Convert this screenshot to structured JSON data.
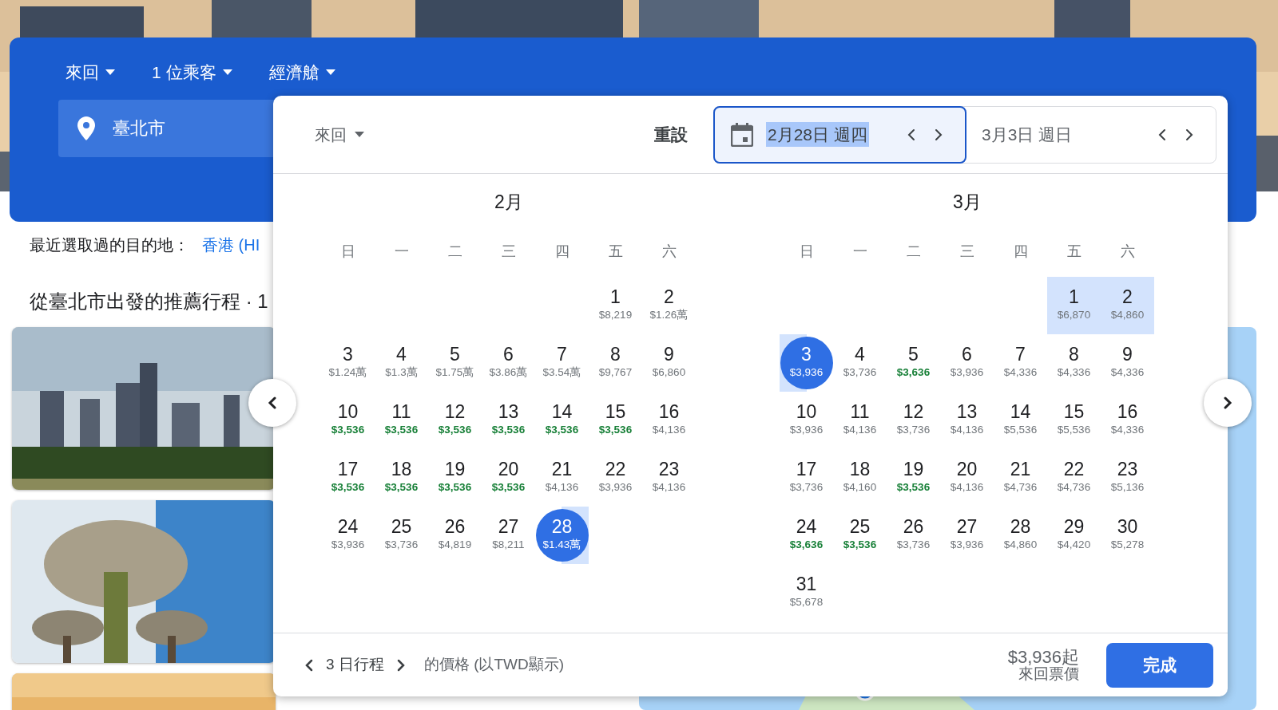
{
  "search_bar": {
    "trip_type": "來回",
    "passengers": "1 位乘客",
    "cabin": "經濟艙",
    "origin": "臺北市"
  },
  "recent": {
    "label": "最近選取過的目的地：",
    "destination": "香港 (HI"
  },
  "recommend_title": "從臺北市出發的推薦行程 · 1",
  "date_picker": {
    "trip_type": "來回",
    "reset": "重設",
    "fields": [
      {
        "text": "2月28日 週四",
        "focused": true
      },
      {
        "text": "3月3日 週日",
        "focused": false
      }
    ],
    "months": [
      {
        "title": "2月",
        "weekdays": [
          "日",
          "一",
          "二",
          "三",
          "四",
          "五",
          "六"
        ],
        "weeks": [
          {
            "kind": "first",
            "days": [
              {
                "day": "1",
                "price": "$8,219",
                "cheap": false,
                "selected": false,
                "in_range": false
              },
              {
                "day": "2",
                "price": "$1.26萬",
                "cheap": false,
                "selected": false,
                "in_range": false
              }
            ]
          },
          {
            "kind": "full",
            "days": [
              {
                "day": "3",
                "price": "$1.24萬",
                "cheap": false,
                "selected": false,
                "in_range": false
              },
              {
                "day": "4",
                "price": "$1.3萬",
                "cheap": false,
                "selected": false,
                "in_range": false
              },
              {
                "day": "5",
                "price": "$1.75萬",
                "cheap": false,
                "selected": false,
                "in_range": false
              },
              {
                "day": "6",
                "price": "$3.86萬",
                "cheap": false,
                "selected": false,
                "in_range": false
              },
              {
                "day": "7",
                "price": "$3.54萬",
                "cheap": false,
                "selected": false,
                "in_range": false
              },
              {
                "day": "8",
                "price": "$9,767",
                "cheap": false,
                "selected": false,
                "in_range": false
              },
              {
                "day": "9",
                "price": "$6,860",
                "cheap": false,
                "selected": false,
                "in_range": false
              }
            ]
          },
          {
            "kind": "full",
            "days": [
              {
                "day": "10",
                "price": "$3,536",
                "cheap": true,
                "selected": false,
                "in_range": false
              },
              {
                "day": "11",
                "price": "$3,536",
                "cheap": true,
                "selected": false,
                "in_range": false
              },
              {
                "day": "12",
                "price": "$3,536",
                "cheap": true,
                "selected": false,
                "in_range": false
              },
              {
                "day": "13",
                "price": "$3,536",
                "cheap": true,
                "selected": false,
                "in_range": false
              },
              {
                "day": "14",
                "price": "$3,536",
                "cheap": true,
                "selected": false,
                "in_range": false
              },
              {
                "day": "15",
                "price": "$3,536",
                "cheap": true,
                "selected": false,
                "in_range": false
              },
              {
                "day": "16",
                "price": "$4,136",
                "cheap": false,
                "selected": false,
                "in_range": false
              }
            ]
          },
          {
            "kind": "full",
            "days": [
              {
                "day": "17",
                "price": "$3,536",
                "cheap": true,
                "selected": false,
                "in_range": false
              },
              {
                "day": "18",
                "price": "$3,536",
                "cheap": true,
                "selected": false,
                "in_range": false
              },
              {
                "day": "19",
                "price": "$3,536",
                "cheap": true,
                "selected": false,
                "in_range": false
              },
              {
                "day": "20",
                "price": "$3,536",
                "cheap": true,
                "selected": false,
                "in_range": false
              },
              {
                "day": "21",
                "price": "$4,136",
                "cheap": false,
                "selected": false,
                "in_range": false
              },
              {
                "day": "22",
                "price": "$3,936",
                "cheap": false,
                "selected": false,
                "in_range": false
              },
              {
                "day": "23",
                "price": "$4,136",
                "cheap": false,
                "selected": false,
                "in_range": false
              }
            ]
          },
          {
            "kind": "last",
            "days": [
              {
                "day": "24",
                "price": "$3,936",
                "cheap": false,
                "selected": false,
                "in_range": false
              },
              {
                "day": "25",
                "price": "$3,736",
                "cheap": false,
                "selected": false,
                "in_range": false
              },
              {
                "day": "26",
                "price": "$4,819",
                "cheap": false,
                "selected": false,
                "in_range": false
              },
              {
                "day": "27",
                "price": "$8,211",
                "cheap": false,
                "selected": false,
                "in_range": false
              },
              {
                "day": "28",
                "price": "$1.43萬",
                "cheap": false,
                "selected": true,
                "in_range": false
              }
            ]
          }
        ]
      },
      {
        "title": "3月",
        "weekdays": [
          "日",
          "一",
          "二",
          "三",
          "四",
          "五",
          "六"
        ],
        "weeks": [
          {
            "kind": "first",
            "days": [
              {
                "day": "1",
                "price": "$6,870",
                "cheap": false,
                "selected": false,
                "in_range": true
              },
              {
                "day": "2",
                "price": "$4,860",
                "cheap": false,
                "selected": false,
                "in_range": true
              }
            ]
          },
          {
            "kind": "full",
            "days": [
              {
                "day": "3",
                "price": "$3,936",
                "cheap": false,
                "selected": true,
                "in_range": false
              },
              {
                "day": "4",
                "price": "$3,736",
                "cheap": false,
                "selected": false,
                "in_range": false
              },
              {
                "day": "5",
                "price": "$3,636",
                "cheap": true,
                "selected": false,
                "in_range": false
              },
              {
                "day": "6",
                "price": "$3,936",
                "cheap": false,
                "selected": false,
                "in_range": false
              },
              {
                "day": "7",
                "price": "$4,336",
                "cheap": false,
                "selected": false,
                "in_range": false
              },
              {
                "day": "8",
                "price": "$4,336",
                "cheap": false,
                "selected": false,
                "in_range": false
              },
              {
                "day": "9",
                "price": "$4,336",
                "cheap": false,
                "selected": false,
                "in_range": false
              }
            ]
          },
          {
            "kind": "full",
            "days": [
              {
                "day": "10",
                "price": "$3,936",
                "cheap": false,
                "selected": false,
                "in_range": false
              },
              {
                "day": "11",
                "price": "$4,136",
                "cheap": false,
                "selected": false,
                "in_range": false
              },
              {
                "day": "12",
                "price": "$3,736",
                "cheap": false,
                "selected": false,
                "in_range": false
              },
              {
                "day": "13",
                "price": "$4,136",
                "cheap": false,
                "selected": false,
                "in_range": false
              },
              {
                "day": "14",
                "price": "$5,536",
                "cheap": false,
                "selected": false,
                "in_range": false
              },
              {
                "day": "15",
                "price": "$5,536",
                "cheap": false,
                "selected": false,
                "in_range": false
              },
              {
                "day": "16",
                "price": "$4,336",
                "cheap": false,
                "selected": false,
                "in_range": false
              }
            ]
          },
          {
            "kind": "full",
            "days": [
              {
                "day": "17",
                "price": "$3,736",
                "cheap": false,
                "selected": false,
                "in_range": false
              },
              {
                "day": "18",
                "price": "$4,160",
                "cheap": false,
                "selected": false,
                "in_range": false
              },
              {
                "day": "19",
                "price": "$3,536",
                "cheap": true,
                "selected": false,
                "in_range": false
              },
              {
                "day": "20",
                "price": "$4,136",
                "cheap": false,
                "selected": false,
                "in_range": false
              },
              {
                "day": "21",
                "price": "$4,736",
                "cheap": false,
                "selected": false,
                "in_range": false
              },
              {
                "day": "22",
                "price": "$4,736",
                "cheap": false,
                "selected": false,
                "in_range": false
              },
              {
                "day": "23",
                "price": "$5,136",
                "cheap": false,
                "selected": false,
                "in_range": false
              }
            ]
          },
          {
            "kind": "full",
            "days": [
              {
                "day": "24",
                "price": "$3,636",
                "cheap": true,
                "selected": false,
                "in_range": false
              },
              {
                "day": "25",
                "price": "$3,536",
                "cheap": true,
                "selected": false,
                "in_range": false
              },
              {
                "day": "26",
                "price": "$3,736",
                "cheap": false,
                "selected": false,
                "in_range": false
              },
              {
                "day": "27",
                "price": "$3,936",
                "cheap": false,
                "selected": false,
                "in_range": false
              },
              {
                "day": "28",
                "price": "$4,860",
                "cheap": false,
                "selected": false,
                "in_range": false
              },
              {
                "day": "29",
                "price": "$4,420",
                "cheap": false,
                "selected": false,
                "in_range": false
              },
              {
                "day": "30",
                "price": "$5,278",
                "cheap": false,
                "selected": false,
                "in_range": false
              }
            ]
          },
          {
            "kind": "last",
            "days": [
              {
                "day": "31",
                "price": "$5,678",
                "cheap": false,
                "selected": false,
                "in_range": false
              }
            ]
          }
        ]
      }
    ],
    "footer": {
      "duration": "3 日行程",
      "price_note": "的價格 (以TWD顯示)",
      "lowest_price": "$3,936起",
      "price_type": "來回票價",
      "done": "完成"
    }
  }
}
